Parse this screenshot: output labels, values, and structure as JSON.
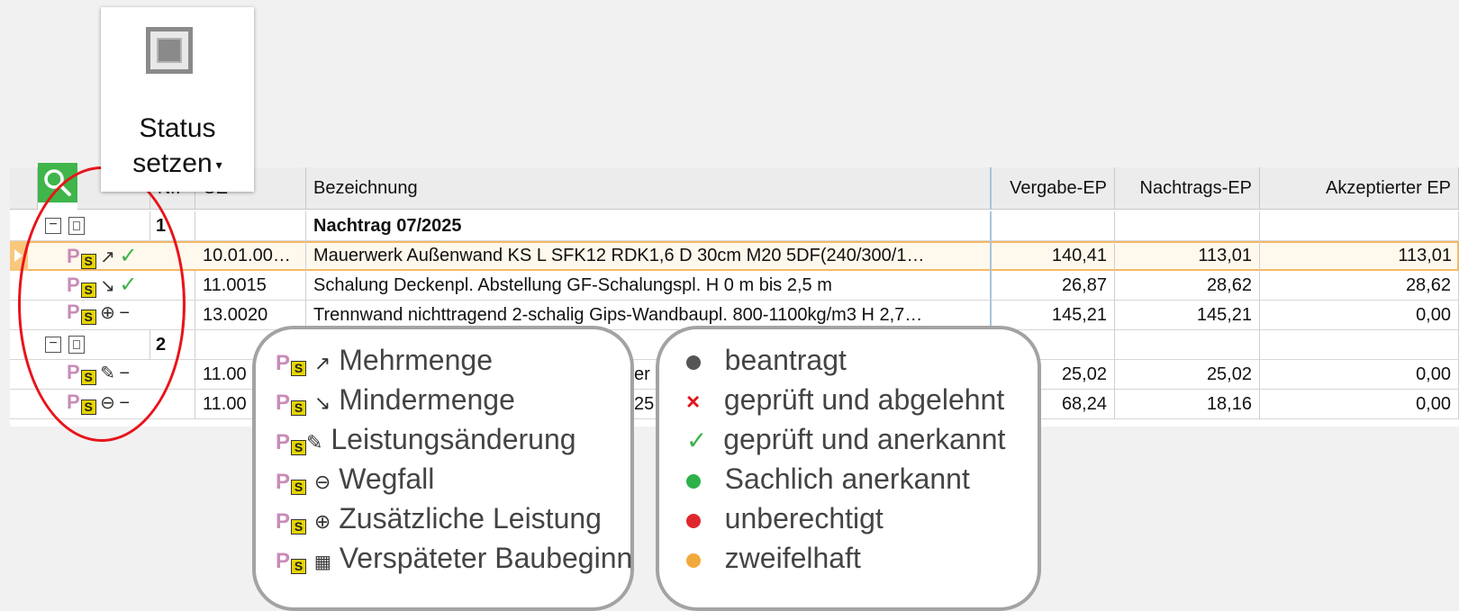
{
  "status_button": {
    "line1": "Status",
    "line2": "setzen",
    "caret": "▾",
    "icon": "status-square-icon"
  },
  "grid": {
    "columns": {
      "nr": "Nr.",
      "oz": "OZ",
      "bezeichnung": "Bezeichnung",
      "vergabe_ep": "Vergabe-EP",
      "nachtrags_ep": "Nachtrags-EP",
      "akzeptierter_ep": "Akzeptierter EP"
    },
    "rows": [
      {
        "type": "group",
        "nr": "1",
        "bezeichnung": "Nachtrag 07/2025"
      },
      {
        "type": "item",
        "type_symbol": "↗",
        "status_symbol": "✓",
        "oz": "10.01.00…",
        "bezeichnung": "Mauerwerk Außenwand KS L SFK12 RDK1,6 D 30cm M20 5DF(240/300/1…",
        "vergabe_ep": "140,41",
        "nachtrags_ep": "113,01",
        "akzeptierter_ep": "113,01"
      },
      {
        "type": "item",
        "type_symbol": "↘",
        "status_symbol": "✓",
        "oz": "11.0015",
        "bezeichnung": "Schalung Deckenpl. Abstellung GF-Schalungspl. H 0 m bis 2,5 m",
        "vergabe_ep": "26,87",
        "nachtrags_ep": "28,62",
        "akzeptierter_ep": "28,62"
      },
      {
        "type": "item",
        "type_symbol": "⊕",
        "status_symbol": "−",
        "oz": "13.0020",
        "bezeichnung": "Trennwand nichttragend 2-schalig Gips-Wandbaupl. 800-1100kg/m3 H 2,7…",
        "vergabe_ep": "145,21",
        "nachtrags_ep": "145,21",
        "akzeptierter_ep": "0,00"
      },
      {
        "type": "group",
        "nr": "2",
        "bezeichnung": ""
      },
      {
        "type": "item",
        "type_symbol": "✎",
        "status_symbol": "−",
        "oz": "11.00",
        "bezeichnung": "er",
        "vergabe_ep": "25,02",
        "nachtrags_ep": "25,02",
        "akzeptierter_ep": "0,00"
      },
      {
        "type": "item",
        "type_symbol": "⊖",
        "status_symbol": "−",
        "oz": "11.00",
        "bezeichnung": "25",
        "vergabe_ep": "68,24",
        "nachtrags_ep": "18,16",
        "akzeptierter_ep": "0,00"
      }
    ]
  },
  "legend_types": {
    "items": [
      {
        "symbol": "↗",
        "label": "Mehrmenge"
      },
      {
        "symbol": "↘",
        "label": "Mindermenge"
      },
      {
        "symbol": "✎",
        "label": "Leistungsänderung"
      },
      {
        "symbol": "⊖",
        "label": "Wegfall"
      },
      {
        "symbol": "⊕",
        "label": "Zusätzliche Leistung"
      },
      {
        "symbol": "▦",
        "label": "Verspäteter Baubeginn"
      }
    ]
  },
  "legend_status": {
    "items": [
      {
        "marker": "dot",
        "color": "#555555",
        "label": "beantragt"
      },
      {
        "marker": "×",
        "color": "#e0161d",
        "label": "geprüft und abgelehnt"
      },
      {
        "marker": "✓",
        "color": "#3cb34a",
        "label": "geprüft und anerkannt"
      },
      {
        "marker": "dot",
        "color": "#2fb14a",
        "label": "Sachlich anerkannt"
      },
      {
        "marker": "dot",
        "color": "#e0262d",
        "label": "unberechtigt"
      },
      {
        "marker": "dot",
        "color": "#f2a93b",
        "label": "zweifelhaft"
      }
    ]
  },
  "colors": {
    "selection": "#f4b968",
    "search_bg": "#3fb54a",
    "highlight_ellipse": "#e8141b"
  }
}
